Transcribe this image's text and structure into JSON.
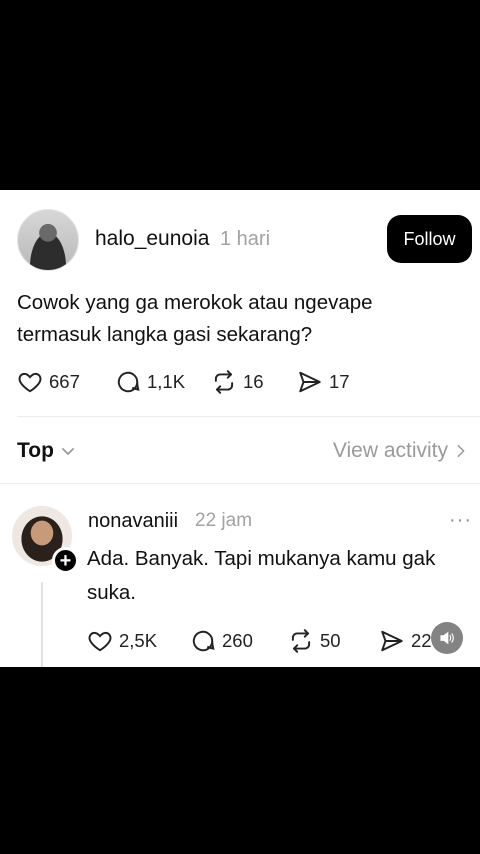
{
  "post": {
    "username": "halo_eunoia",
    "time": "1 hari",
    "follow_label": "Follow",
    "text": "Cowok yang ga merokok atau ngevape termasuk langka gasi sekarang?",
    "likes": "667",
    "comments": "1,1K",
    "reposts": "16",
    "shares": "17"
  },
  "sort": {
    "label": "Top",
    "view_activity": "View activity"
  },
  "reply": {
    "username": "nonavaniii",
    "time": "22 jam",
    "more": "···",
    "text": "Ada. Banyak. Tapi mukanya kamu gak suka.",
    "likes": "2,5K",
    "comments": "260",
    "reposts": "50",
    "shares": "22"
  },
  "icons": {
    "like": "heart-icon",
    "comment": "comment-bubble-icon",
    "repost": "repost-icon",
    "share": "send-icon",
    "volume": "volume-icon"
  }
}
